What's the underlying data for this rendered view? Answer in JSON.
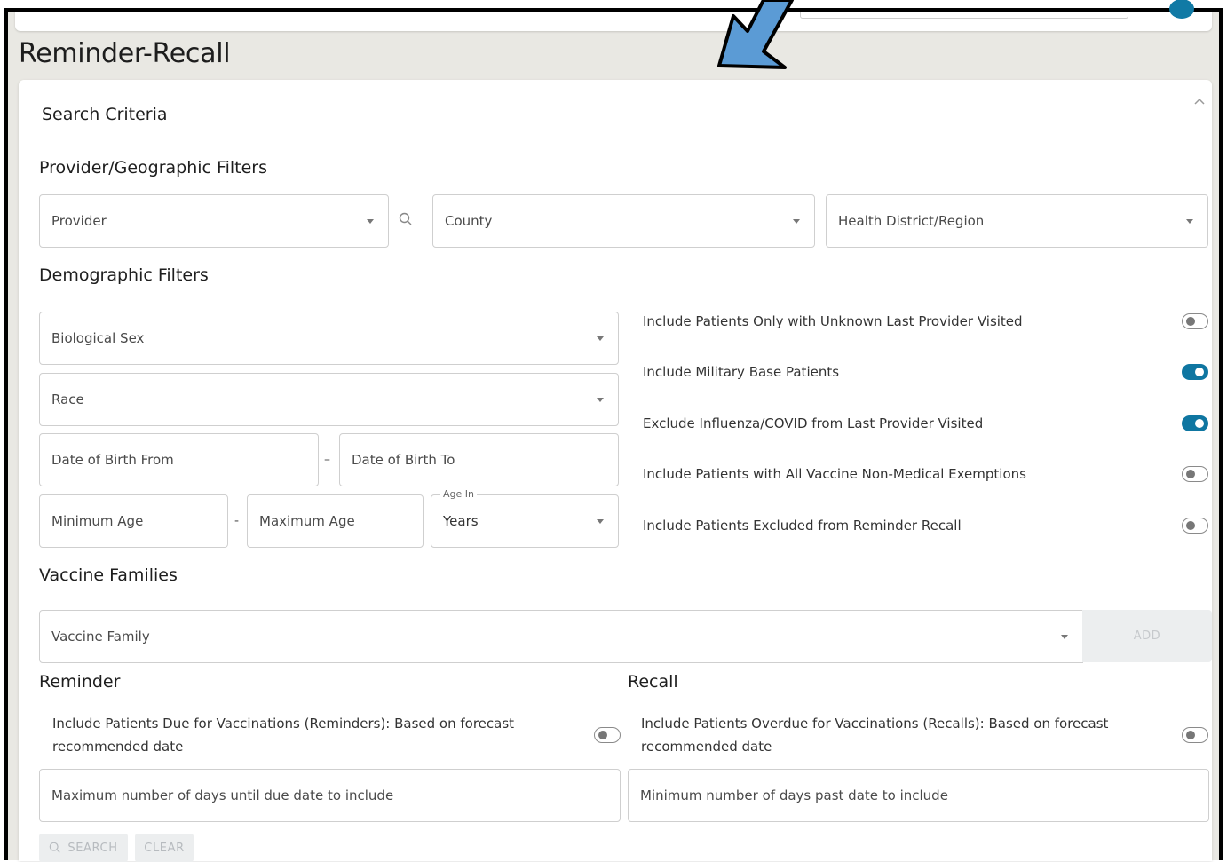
{
  "page": {
    "title": "Reminder-Recall"
  },
  "card": {
    "title": "Search Criteria"
  },
  "sections": {
    "provider_geo": "Provider/Geographic Filters",
    "demographic": "Demographic Filters",
    "vaccine_families": "Vaccine Families",
    "reminder": "Reminder",
    "recall": "Recall"
  },
  "fields": {
    "provider": "Provider",
    "county": "County",
    "health_district": "Health District/Region",
    "biological_sex": "Biological Sex",
    "race": "Race",
    "dob_from": "Date of Birth From",
    "dob_sep": "–",
    "dob_to": "Date of Birth To",
    "min_age": "Minimum Age",
    "age_sep": "-",
    "max_age": "Maximum Age",
    "age_in_label": "Age In",
    "age_in_value": "Years",
    "vaccine_family": "Vaccine Family",
    "max_days_due": "Maximum number of days until due date to include",
    "min_days_past": "Minimum number of days past date to include"
  },
  "toggles": [
    {
      "label": "Include Patients Only with Unknown Last Provider Visited",
      "on": false
    },
    {
      "label": "Include Military Base Patients",
      "on": true
    },
    {
      "label": "Exclude Influenza/COVID from Last Provider Visited",
      "on": true
    },
    {
      "label": "Include Patients with All Vaccine Non-Medical Exemptions",
      "on": false
    },
    {
      "label": "Include Patients Excluded from Reminder Recall",
      "on": false
    }
  ],
  "reminder": {
    "toggle_label": "Include Patients Due for Vaccinations (Reminders): Based on forecast recommended date",
    "on": false
  },
  "recall": {
    "toggle_label": "Include Patients Overdue for Vaccinations (Recalls): Based on forecast recommended date",
    "on": false
  },
  "buttons": {
    "add": "ADD",
    "search": "SEARCH",
    "clear": "CLEAR"
  },
  "colors": {
    "accent": "#0f76a1",
    "arrow_fill": "#5b9bd5",
    "background": "#e9e8e3"
  },
  "icons": {
    "collapse": "chevron-up-icon",
    "provider_lookup": "search-icon",
    "search_button": "search-icon"
  }
}
